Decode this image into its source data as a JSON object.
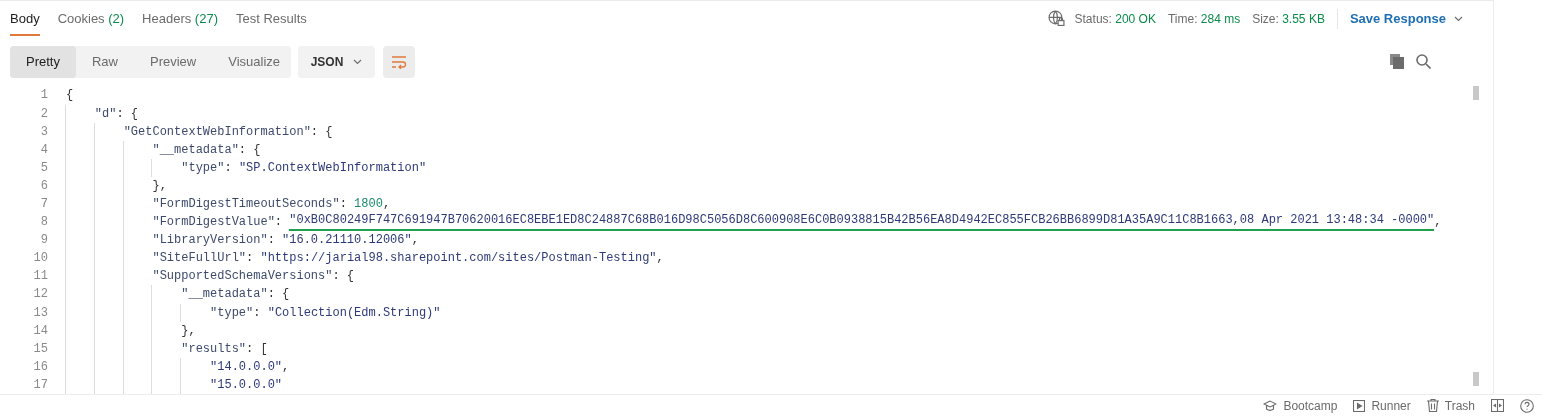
{
  "response_tabs": [
    {
      "label": "Body",
      "selected": true
    },
    {
      "label": "Cookies",
      "count": "(2)",
      "selected": false
    },
    {
      "label": "Headers",
      "count": "(27)",
      "selected": false
    },
    {
      "label": "Test Results",
      "selected": false
    }
  ],
  "status": [
    {
      "label": "Status:",
      "value": "200 OK"
    },
    {
      "label": "Time:",
      "value": "284 ms"
    },
    {
      "label": "Size:",
      "value": "3.55 KB"
    }
  ],
  "save_response": "Save Response",
  "view_modes": [
    {
      "label": "Pretty",
      "selected": true
    },
    {
      "label": "Raw",
      "selected": false
    },
    {
      "label": "Preview",
      "selected": false
    },
    {
      "label": "Visualize",
      "selected": false
    }
  ],
  "format": "JSON",
  "code_lines": [
    {
      "number": "1",
      "tokens": [
        {
          "kind": "punct",
          "text": "{"
        }
      ]
    },
    {
      "number": "2",
      "tokens": [
        {
          "kind": "key",
          "text": "    \"d\""
        },
        {
          "kind": "punct",
          "text": ": {"
        }
      ]
    },
    {
      "number": "3",
      "tokens": [
        {
          "kind": "key",
          "text": "        \"GetContextWebInformation\""
        },
        {
          "kind": "punct",
          "text": ": {"
        }
      ]
    },
    {
      "number": "4",
      "tokens": [
        {
          "kind": "key",
          "text": "            \"__metadata\""
        },
        {
          "kind": "punct",
          "text": ": {"
        }
      ]
    },
    {
      "number": "5",
      "tokens": [
        {
          "kind": "key",
          "text": "                \"type\""
        },
        {
          "kind": "punct",
          "text": ": "
        },
        {
          "kind": "string",
          "text": "\"SP.ContextWebInformation\""
        }
      ]
    },
    {
      "number": "6",
      "tokens": [
        {
          "kind": "punct",
          "text": "            },"
        }
      ]
    },
    {
      "number": "7",
      "tokens": [
        {
          "kind": "key",
          "text": "            \"FormDigestTimeoutSeconds\""
        },
        {
          "kind": "punct",
          "text": ": "
        },
        {
          "kind": "number",
          "text": "1800"
        },
        {
          "kind": "punct",
          "text": ","
        }
      ]
    },
    {
      "number": "8",
      "tokens": [
        {
          "kind": "key",
          "text": "            \"FormDigestValue\""
        },
        {
          "kind": "punct",
          "text": ": "
        },
        {
          "kind": "string",
          "text": "\"0xB0C80249F747C691947B70620016EC8EBE1ED8C24887C68B016D98C5056D8C600908E6C0B0938815B42B56EA8D4942EC855FCB26BB6899D81A35A9C11C8B1663,08 Apr 2021 13:48:34 -0000\"",
          "underlined": true
        },
        {
          "kind": "punct",
          "text": ","
        }
      ]
    },
    {
      "number": "9",
      "tokens": [
        {
          "kind": "key",
          "text": "            \"LibraryVersion\""
        },
        {
          "kind": "punct",
          "text": ": "
        },
        {
          "kind": "string",
          "text": "\"16.0.21110.12006\""
        },
        {
          "kind": "punct",
          "text": ","
        }
      ]
    },
    {
      "number": "10",
      "tokens": [
        {
          "kind": "key",
          "text": "            \"SiteFullUrl\""
        },
        {
          "kind": "punct",
          "text": ": "
        },
        {
          "kind": "string",
          "text": "\"https://jarial98.sharepoint.com/sites/Postman-Testing\""
        },
        {
          "kind": "punct",
          "text": ","
        }
      ]
    },
    {
      "number": "11",
      "tokens": [
        {
          "kind": "key",
          "text": "            \"SupportedSchemaVersions\""
        },
        {
          "kind": "punct",
          "text": ": {"
        }
      ]
    },
    {
      "number": "12",
      "tokens": [
        {
          "kind": "key",
          "text": "                \"__metadata\""
        },
        {
          "kind": "punct",
          "text": ": {"
        }
      ]
    },
    {
      "number": "13",
      "tokens": [
        {
          "kind": "key",
          "text": "                    \"type\""
        },
        {
          "kind": "punct",
          "text": ": "
        },
        {
          "kind": "string",
          "text": "\"Collection(Edm.String)\""
        }
      ]
    },
    {
      "number": "14",
      "tokens": [
        {
          "kind": "punct",
          "text": "                },"
        }
      ]
    },
    {
      "number": "15",
      "tokens": [
        {
          "kind": "key",
          "text": "                \"results\""
        },
        {
          "kind": "punct",
          "text": ": ["
        }
      ]
    },
    {
      "number": "16",
      "tokens": [
        {
          "kind": "string",
          "text": "                    \"14.0.0.0\""
        },
        {
          "kind": "punct",
          "text": ","
        }
      ]
    },
    {
      "number": "17",
      "tokens": [
        {
          "kind": "string",
          "text": "                    \"15.0.0.0\""
        }
      ]
    }
  ],
  "status_bar": [
    {
      "kind": "bootcamp",
      "label": "Bootcamp"
    },
    {
      "kind": "runner",
      "label": "Runner"
    },
    {
      "kind": "trash",
      "label": "Trash"
    },
    {
      "kind": "panes"
    },
    {
      "kind": "help"
    }
  ]
}
